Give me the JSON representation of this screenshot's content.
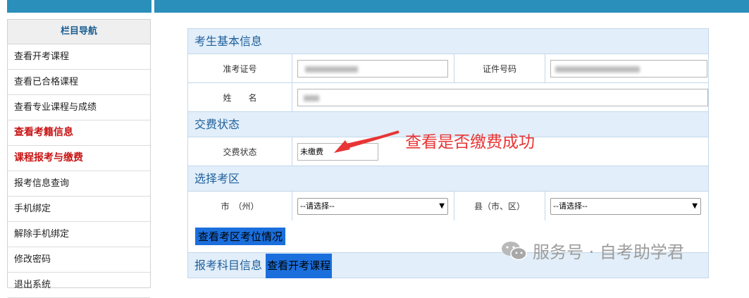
{
  "sidebar": {
    "title": "栏目导航",
    "items": [
      {
        "label": "查看开考课程",
        "highlight": false
      },
      {
        "label": "查看已合格课程",
        "highlight": false
      },
      {
        "label": "查看专业课程与成绩",
        "highlight": false
      },
      {
        "label": "查看考籍信息",
        "highlight": true
      },
      {
        "label": "课程报考与缴费",
        "highlight": true
      },
      {
        "label": "报考信息查询",
        "highlight": false
      },
      {
        "label": "手机绑定",
        "highlight": false
      },
      {
        "label": "解除手机绑定",
        "highlight": false
      },
      {
        "label": "修改密码",
        "highlight": false
      },
      {
        "label": "退出系统",
        "highlight": false
      }
    ]
  },
  "basic_info": {
    "title": "考生基本信息",
    "exam_no_label": "准考证号",
    "id_label": "证件号码",
    "name_label": "姓　　名"
  },
  "payment": {
    "title": "交费状态",
    "status_label": "交费状态",
    "status_value": "未缴费"
  },
  "region": {
    "title": "选择考区",
    "city_label": "市　（州）",
    "county_label": "县（市、区）",
    "city_select": "--请选择--",
    "county_select": "--请选择--",
    "check_button": "查看考区考位情况"
  },
  "subjects": {
    "title": "报考科目信息",
    "courses_button": "查看开考课程"
  },
  "annotation": "查看是否缴费成功",
  "watermark": "服务号 · 自考助学君",
  "colors": {
    "topbar": "#2a8fba",
    "section_bg": "#e2eef9",
    "section_text": "#1e5f9c",
    "highlight_red": "#c81414",
    "annotation_red": "#e83535",
    "button_blue": "#1b6fdc"
  }
}
